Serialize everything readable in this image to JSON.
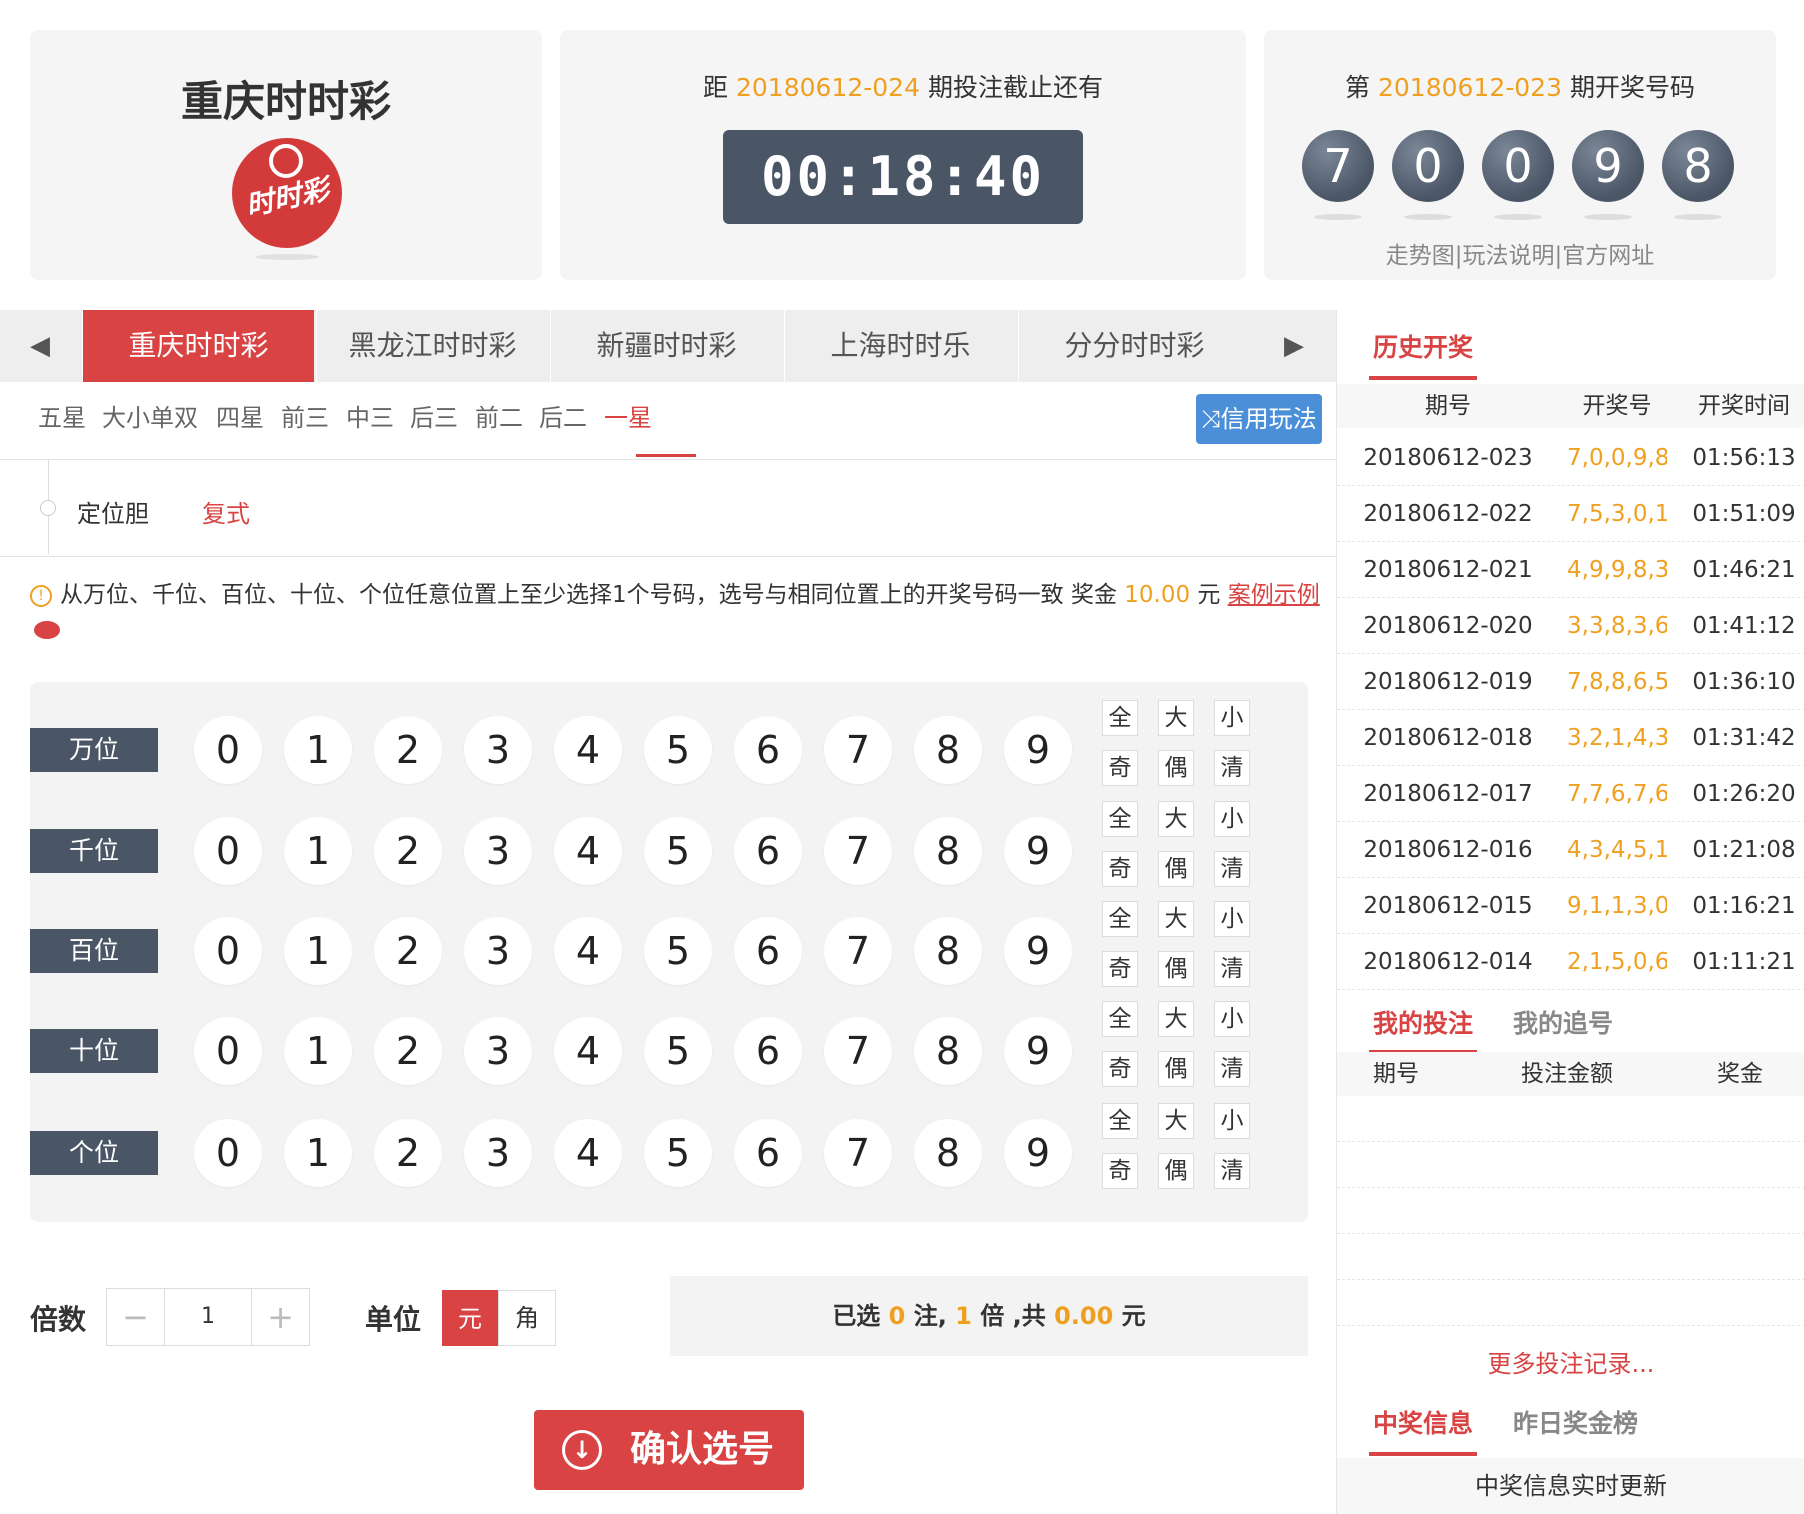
{
  "lottery": {
    "name": "重庆时时彩",
    "logo_text": "时时彩"
  },
  "countdown": {
    "prefix": "距",
    "period": "20180612-024",
    "suffix": "期投注截止还有",
    "time": "00:18:40"
  },
  "last_draw": {
    "prefix": "第",
    "period": "20180612-023",
    "suffix": "期开奖号码",
    "numbers": [
      "7",
      "0",
      "0",
      "9",
      "8"
    ],
    "links": [
      "走势图",
      "玩法说明",
      "官方网址"
    ],
    "separator": "|"
  },
  "tabs": {
    "prev_icon": "◀",
    "next_icon": "▶",
    "items": [
      "重庆时时彩",
      "黑龙江时时彩",
      "新疆时时彩",
      "上海时时乐",
      "分分时时彩"
    ],
    "active": 0
  },
  "subtabs": {
    "items": [
      "五星",
      "大小单双",
      "四星",
      "前三",
      "中三",
      "后三",
      "前二",
      "后二",
      "一星"
    ],
    "active": 8
  },
  "credit_button": {
    "icon": "⤨",
    "label": "信用玩法"
  },
  "modes": {
    "dingwei": "定位胆",
    "fushi": "复式"
  },
  "description": {
    "icon": "!",
    "text_before": "从万位、千位、百位、十位、个位任意位置上至少选择1个号码，选号与相同位置上的开奖号码一致 奖金 ",
    "prize": "10.00",
    "unit": " 元 ",
    "example_link": "案例示例"
  },
  "board": {
    "rows": [
      "万位",
      "千位",
      "百位",
      "十位",
      "个位"
    ],
    "digits": [
      "0",
      "1",
      "2",
      "3",
      "4",
      "5",
      "6",
      "7",
      "8",
      "9"
    ],
    "quick_top": [
      "全",
      "大",
      "小"
    ],
    "quick_bottom": [
      "奇",
      "偶",
      "清"
    ]
  },
  "multiplier": {
    "label": "倍数",
    "minus": "−",
    "value": "1",
    "plus": "+"
  },
  "unit": {
    "label": "单位",
    "yuan": "元",
    "jiao": "角"
  },
  "summary": {
    "p1": "已选 ",
    "count": "0",
    "p2": " 注, ",
    "times": "1",
    "p3": " 倍 ,共 ",
    "amount": "0.00",
    "p4": " 元"
  },
  "confirm": {
    "icon": "↓",
    "label": "确认选号"
  },
  "history": {
    "tab": "历史开奖",
    "headers": [
      "期号",
      "开奖号",
      "开奖时间"
    ],
    "rows": [
      {
        "period": "20180612-023",
        "numbers": "7,0,0,9,8",
        "time": "01:56:13"
      },
      {
        "period": "20180612-022",
        "numbers": "7,5,3,0,1",
        "time": "01:51:09"
      },
      {
        "period": "20180612-021",
        "numbers": "4,9,9,8,3",
        "time": "01:46:21"
      },
      {
        "period": "20180612-020",
        "numbers": "3,3,8,3,6",
        "time": "01:41:12"
      },
      {
        "period": "20180612-019",
        "numbers": "7,8,8,6,5",
        "time": "01:36:10"
      },
      {
        "period": "20180612-018",
        "numbers": "3,2,1,4,3",
        "time": "01:31:42"
      },
      {
        "period": "20180612-017",
        "numbers": "7,7,6,7,6",
        "time": "01:26:20"
      },
      {
        "period": "20180612-016",
        "numbers": "4,3,4,5,1",
        "time": "01:21:08"
      },
      {
        "period": "20180612-015",
        "numbers": "9,1,1,3,0",
        "time": "01:16:21"
      },
      {
        "period": "20180612-014",
        "numbers": "2,1,5,0,6",
        "time": "01:11:21"
      }
    ]
  },
  "my_bets": {
    "tab_active": "我的投注",
    "tab_other": "我的追号",
    "headers": [
      "期号",
      "投注金额",
      "奖金"
    ],
    "more": "更多投注记录..."
  },
  "winners": {
    "tab_active": "中奖信息",
    "tab_other": "昨日奖金榜",
    "live": "中奖信息实时更新"
  },
  "colors": {
    "accent_red": "#d94343",
    "highlight": "#f0a020",
    "slate": "#4a5566",
    "credit_blue": "#4b8fd8"
  }
}
